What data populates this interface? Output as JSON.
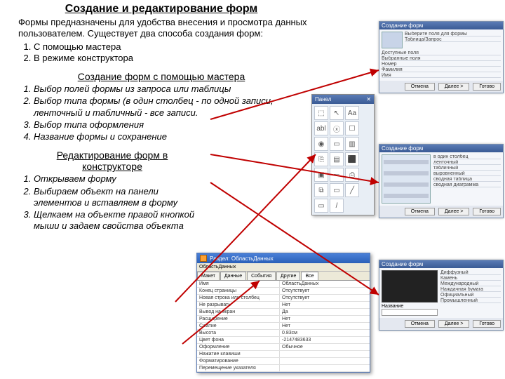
{
  "title": "Создание и редактирование форм",
  "intro": "Формы предназначены для удобства внесения и просмотра данных пользователем. Существует два способа создания форм:",
  "methods": [
    "С помощью мастера",
    "В режиме конструктора"
  ],
  "wizard_title": "Создание форм с помощью мастера",
  "wizard_steps": [
    "Выбор полей формы из запроса или таблицы",
    "Выбор типа формы (в один столбец - по одной записи, ленточный и табличный - все записи.",
    "Выбор типа оформления",
    "Название формы и сохранение"
  ],
  "editor_title": "Редактирование форм в конструкторе",
  "editor_steps": [
    "Открываем форму",
    "Выбираем объект на панели элементов и вставляем в форму",
    "Щелкаем на объекте правой кнопкой мыши и задаем свойства объекта"
  ],
  "palette": {
    "title": "Панел",
    "close": "✕",
    "icons": [
      "⬚",
      "↖",
      "Aa",
      "abl",
      "ⓧ",
      "☐",
      "◉",
      "▭",
      "▥",
      "⎘",
      "▤",
      "⬛",
      "▣",
      "⎓",
      "⎙",
      "⧉",
      "▭",
      "╱",
      "▭",
      "/"
    ]
  },
  "wizard_dialog1": {
    "title": "Создание форм",
    "lines": [
      "Выберите поля для формы",
      "Таблица/Запрос",
      "Доступные поля",
      "Выбранные поля",
      "Номер",
      "Фамилия",
      "Имя"
    ],
    "btn_ok": "Готово",
    "btn_next": "Далее >",
    "btn_cancel": "Отмена"
  },
  "wizard_dialog2": {
    "title": "Создание форм",
    "lines": [
      "в один столбец",
      "ленточный",
      "табличный",
      "выровненный",
      "сводная таблица",
      "сводная диаграмма"
    ],
    "btn_ok": "Готово",
    "btn_next": "Далее >",
    "btn_cancel": "Отмена"
  },
  "wizard_dialog3": {
    "title": "Создание форм",
    "lines": [
      "Диффузный",
      "Камень",
      "Международный",
      "Наждачная бумага",
      "Официальный",
      "Промышленный"
    ],
    "label": "Название",
    "btn_ok": "Готово",
    "btn_next": "Далее >",
    "btn_cancel": "Отмена"
  },
  "propwin": {
    "title": "Раздел: ОбластьДанных",
    "object": "ОбластьДанных",
    "tabs": [
      "Макет",
      "Данные",
      "События",
      "Другие",
      "Все"
    ],
    "rows": [
      [
        "Имя",
        "ОбластьДанных"
      ],
      [
        "Конец страницы",
        "Отсутствует"
      ],
      [
        "Новая строка или столбец",
        "Отсутствует"
      ],
      [
        "Не разрывать",
        "Нет"
      ],
      [
        "Вывод на экран",
        "Да"
      ],
      [
        "Расширение",
        "Нет"
      ],
      [
        "Сжатие",
        "Нет"
      ],
      [
        "Высота",
        "0.83см"
      ],
      [
        "Цвет фона",
        "-2147483633"
      ],
      [
        "Оформление",
        "Обычное"
      ],
      [
        "Нажатие клавиши",
        ""
      ],
      [
        "Форматирование",
        ""
      ],
      [
        "Перемещение указателя",
        ""
      ]
    ]
  }
}
